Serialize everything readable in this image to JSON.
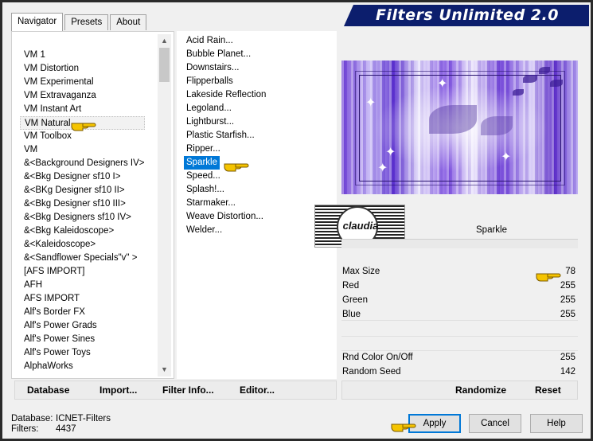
{
  "banner": {
    "title": "Filters Unlimited 2.0"
  },
  "tabs": [
    {
      "label": "Navigator",
      "active": true
    },
    {
      "label": "Presets",
      "active": false
    },
    {
      "label": "About",
      "active": false
    }
  ],
  "categories": [
    "VM 1",
    "VM Distortion",
    "VM Experimental",
    "VM Extravaganza",
    "VM Instant Art",
    "VM Natural",
    "VM Toolbox",
    "VM",
    "&<Background Designers IV>",
    "&<Bkg Designer sf10 I>",
    "&<BKg Designer sf10 II>",
    "&<Bkg Designer sf10 III>",
    "&<Bkg Designers sf10 IV>",
    "&<Bkg Kaleidoscope>",
    "&<Kaleidoscope>",
    "&<Sandflower Specials\"v\" >",
    "[AFS IMPORT]",
    "AFH",
    "AFS IMPORT",
    "Alf's Border FX",
    "Alf's Power Grads",
    "Alf's Power Sines",
    "Alf's Power Toys",
    "AlphaWorks"
  ],
  "selected_category": "VM Natural",
  "filters": [
    "Acid Rain...",
    "Bubble Planet...",
    "Downstairs...",
    "Flipperballs",
    "Lakeside Reflection",
    "Legoland...",
    "Lightburst...",
    "Plastic Starfish...",
    "Ripper...",
    "Sparkle",
    "Speed...",
    "Splash!...",
    "Starmaker...",
    "Weave Distortion...",
    "Welder..."
  ],
  "selected_filter": "Sparkle",
  "watermark": {
    "text": "claudia"
  },
  "filter_name": "Sparkle",
  "params": [
    {
      "name": "Max Size",
      "value": "78"
    },
    {
      "name": "Red",
      "value": "255"
    },
    {
      "name": "Green",
      "value": "255"
    },
    {
      "name": "Blue",
      "value": "255"
    }
  ],
  "params2": [
    {
      "name": "Rnd Color On/Off",
      "value": "255"
    },
    {
      "name": "Random Seed",
      "value": "142"
    }
  ],
  "left_buttons": {
    "database": "Database",
    "import": "Import...",
    "filter_info": "Filter Info...",
    "editor": "Editor..."
  },
  "right_buttons": {
    "randomize": "Randomize",
    "reset": "Reset"
  },
  "status": {
    "db_label": "Database:",
    "db_value": "ICNET-Filters",
    "filters_label": "Filters:",
    "filters_value": "4437"
  },
  "dialog_buttons": {
    "apply": "Apply",
    "cancel": "Cancel",
    "help": "Help"
  },
  "colors": {
    "accent": "#0078d7",
    "banner": "#0c1e6d",
    "pointer": "#f5c400"
  }
}
